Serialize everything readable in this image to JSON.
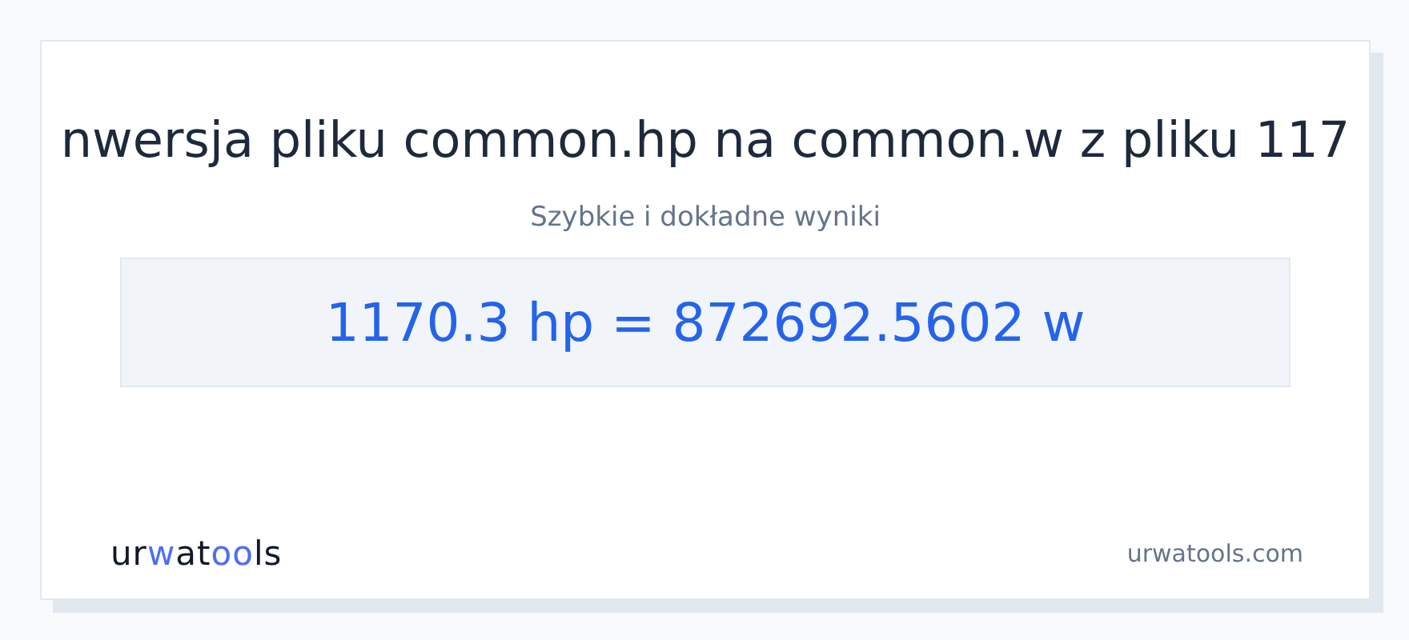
{
  "title": "nwersja pliku common.hp na common.w z pliku 117",
  "subtitle": "Szybkie i dokładne wyniki",
  "result": "1170.3 hp = 872692.5602 w",
  "footer": {
    "logo": [
      {
        "text": "ur",
        "accent": false
      },
      {
        "text": "w",
        "accent": true
      },
      {
        "text": "at",
        "accent": false
      },
      {
        "text": "oo",
        "accent": true
      },
      {
        "text": "ls",
        "accent": false
      }
    ],
    "site": "urwatools.com"
  }
}
